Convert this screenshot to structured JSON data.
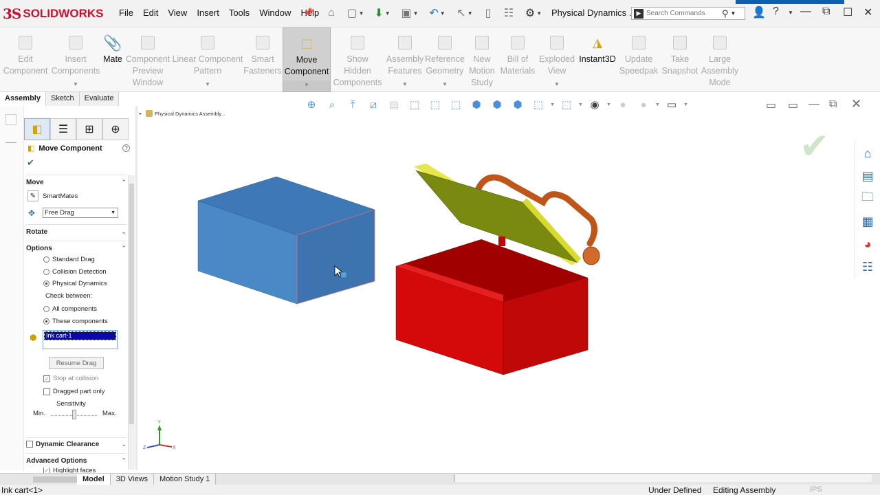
{
  "app": {
    "logo_ds": "3S",
    "logo_name": "SOLIDWORKS",
    "document_title": "Physical Dynamics ...",
    "search_placeholder": "Search Commands"
  },
  "menu": [
    "File",
    "Edit",
    "View",
    "Insert",
    "Tools",
    "Window",
    "Help"
  ],
  "command_manager": {
    "items": [
      {
        "label1": "Edit",
        "label2": "Component",
        "enabled": false
      },
      {
        "label1": "Insert",
        "label2": "Components",
        "enabled": false
      },
      {
        "label1": "Mate",
        "label2": "",
        "enabled": true
      },
      {
        "label1": "Component",
        "label2": "Preview",
        "label3": "Window",
        "enabled": false
      },
      {
        "label1": "Linear Component",
        "label2": "Pattern",
        "enabled": false
      },
      {
        "label1": "Smart",
        "label2": "Fasteners",
        "enabled": false
      },
      {
        "label1": "Move",
        "label2": "Component",
        "enabled": true
      },
      {
        "label1": "Show",
        "label2": "Hidden",
        "label3": "Components",
        "enabled": false
      },
      {
        "label1": "Assembly",
        "label2": "Features",
        "enabled": false
      },
      {
        "label1": "Reference",
        "label2": "Geometry",
        "enabled": false
      },
      {
        "label1": "New",
        "label2": "Motion",
        "label3": "Study",
        "enabled": false
      },
      {
        "label1": "Bill of",
        "label2": "Materials",
        "enabled": false
      },
      {
        "label1": "Exploded",
        "label2": "View",
        "enabled": false
      },
      {
        "label1": "Instant3D",
        "label2": "",
        "enabled": true
      },
      {
        "label1": "Update",
        "label2": "Speedpak",
        "enabled": false
      },
      {
        "label1": "Take",
        "label2": "Snapshot",
        "enabled": false
      },
      {
        "label1": "Large",
        "label2": "Assembly",
        "label3": "Mode",
        "enabled": false
      }
    ]
  },
  "tabs": [
    "Assembly",
    "Sketch",
    "Evaluate"
  ],
  "property_manager": {
    "title": "Move Component",
    "move_section": "Move",
    "smartmates": "SmartMates",
    "drag_mode": "Free Drag",
    "rotate_section": "Rotate",
    "options_section": "Options",
    "opt_standard": "Standard Drag",
    "opt_collision": "Collision Detection",
    "opt_physical": "Physical Dynamics",
    "check_between": "Check between:",
    "opt_all": "All components",
    "opt_these": "These components",
    "selected_item": "Ink cart-1",
    "resume_drag": "Resume Drag",
    "stop_collision": "Stop at collision",
    "dragged_only": "Dragged part only",
    "sensitivity": "Sensitivity",
    "min": "Min.",
    "max": "Max.",
    "dynamic_clearance": "Dynamic Clearance",
    "advanced_options": "Advanced Options",
    "highlight_faces": "Highlight faces",
    "sensitivity_level": 0.5
  },
  "breadcrumb": "Physical Dynamics Assembly...",
  "bottom_tabs": [
    "Model",
    "3D Views",
    "Motion Study 1"
  ],
  "status": {
    "left": "Ink cart<1>",
    "defined": "Under Defined",
    "mode": "Editing Assembly",
    "units": "IPS"
  },
  "colors": {
    "blue_box": "#3f78b6",
    "red_box": "#d40a0a",
    "lid": "#7a8a10",
    "handle": "#c0551a"
  }
}
